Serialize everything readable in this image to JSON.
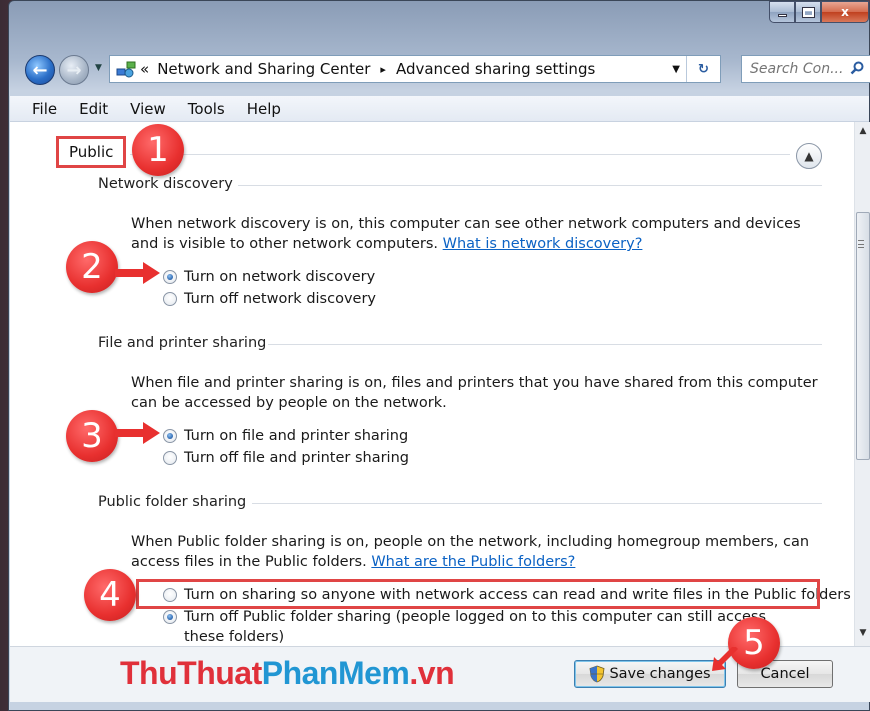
{
  "window": {
    "minimize_glyph": "minimize-icon",
    "maximize_glyph": "maximize-icon",
    "close_label": "x"
  },
  "address_bar": {
    "overflow": "«",
    "crumb1": "Network and Sharing Center",
    "sep": "▸",
    "crumb2": "Advanced sharing settings"
  },
  "search": {
    "placeholder": "Search Con..."
  },
  "menu": {
    "file": "File",
    "edit": "Edit",
    "view": "View",
    "tools": "Tools",
    "help": "Help"
  },
  "profile": {
    "label": "Public"
  },
  "network_discovery": {
    "title": "Network discovery",
    "desc": "When network discovery is on, this computer can see other network computers and devices and is visible to other network computers.",
    "link": "What is network discovery?",
    "opt_on": "Turn on network discovery",
    "opt_off": "Turn off network discovery",
    "selected": "on"
  },
  "file_sharing": {
    "title": "File and printer sharing",
    "desc": "When file and printer sharing is on, files and printers that you have shared from this computer can be accessed by people on the network.",
    "opt_on": "Turn on file and printer sharing",
    "opt_off": "Turn off file and printer sharing",
    "selected": "on"
  },
  "public_folder": {
    "title": "Public folder sharing",
    "desc": "When Public folder sharing is on, people on the network, including homegroup members, can access files in the Public folders.",
    "link": "What are the Public folders?",
    "opt_on": "Turn on sharing so anyone with network access can read and write files in the Public folders",
    "opt_off": "Turn off Public folder sharing (people logged on to this computer can still access these folders)",
    "selected": "off"
  },
  "callouts": {
    "n1": "1",
    "n2": "2",
    "n3": "3",
    "n4": "4",
    "n5": "5"
  },
  "watermark": {
    "part1": "ThuThuat",
    "part2": "PhanMem",
    "part3": ".vn"
  },
  "buttons": {
    "save": "Save changes",
    "cancel": "Cancel"
  },
  "colors": {
    "callout": "#e8302f",
    "link": "#0b62c4",
    "watermark_red": "#e0303a",
    "watermark_blue": "#2196d3"
  }
}
